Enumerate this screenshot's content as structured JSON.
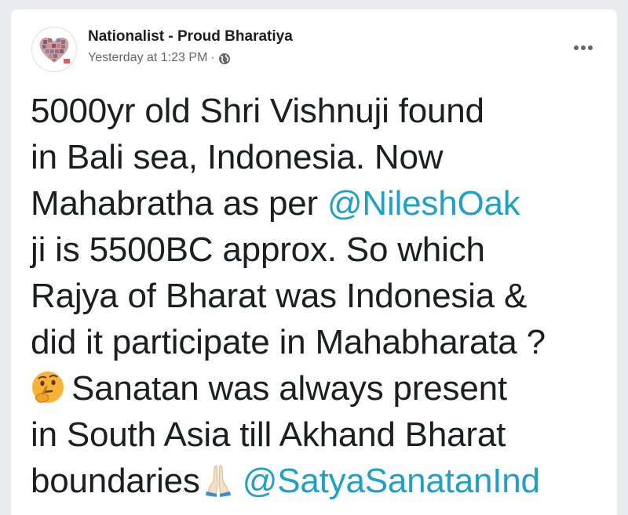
{
  "post": {
    "author": "Nationalist - Proud Bharatiya",
    "timestamp": "Yesterday at 1:23 PM",
    "separator": "·",
    "privacy_icon": "globe-icon",
    "more_icon": "more-options-icon",
    "avatar_icon": "heart-collage-icon"
  },
  "content": {
    "line1": "5000yr old Shri Vishnuji found",
    "line2": "in Bali sea, Indonesia. Now",
    "line3_text": "Mahabratha as per ",
    "line3_mention": "@NileshOak",
    "line4": "ji is 5500BC approx. So which",
    "line5": "Rajya of Bharat was Indonesia &",
    "line6": "did it participate in Mahabharata ?",
    "line7_emoji": "thinking-face-emoji",
    "line7_text": "Sanatan was always present",
    "line8": "in South Asia till Akhand Bharat",
    "line9_text": "boundaries",
    "line9_emoji": "folded-hands-emoji",
    "line9_mention": "@SatyaSanatanInd"
  },
  "colors": {
    "mention": "#1ea1c8",
    "text": "#1c1e21",
    "meta": "#65676b",
    "background": "#e9ebee",
    "card": "#ffffff"
  }
}
